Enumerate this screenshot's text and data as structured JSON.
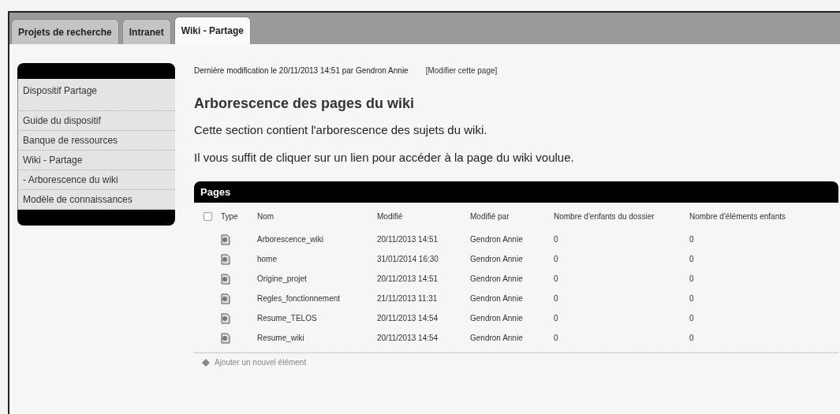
{
  "tabs": [
    {
      "label": "Projets de recherche",
      "selected": false
    },
    {
      "label": "Intranet",
      "selected": false
    },
    {
      "label": "Wiki - Partage",
      "selected": true
    }
  ],
  "sidebar": {
    "items": [
      {
        "label": "Dispositif Partage",
        "kind": "header"
      },
      {
        "label": "Guide du dispositif",
        "kind": "link"
      },
      {
        "label": "Banque de ressources",
        "kind": "link"
      },
      {
        "label": "Wiki - Partage",
        "kind": "link"
      },
      {
        "label": "- Arborescence du wiki",
        "kind": "link"
      },
      {
        "label": "Modèle de connaissances",
        "kind": "link"
      }
    ]
  },
  "meta": {
    "text": "Dernière modification le 20/11/2013 14:51 par Gendron Annie",
    "edit_link": "[Modifier cette page]"
  },
  "heading": "Arborescence des pages du wiki",
  "paragraphs": [
    "Cette section contient l'arborescence des sujets du wiki.",
    "Il vous suffit de cliquer sur un lien pour accéder à la page du wiki voulue."
  ],
  "table": {
    "title": "Pages",
    "select_all_checked": false,
    "columns": [
      "Type",
      "Nom",
      "Modifié",
      "Modifié par",
      "Nombre d'enfants du dossier",
      "Nombre d'éléments enfants"
    ],
    "rows": [
      {
        "cells": [
          "",
          "Arborescence_wiki",
          "20/11/2013 14:51",
          "Gendron Annie",
          "0",
          "0"
        ]
      },
      {
        "cells": [
          "",
          "home",
          "31/01/2014 16:30",
          "Gendron Annie",
          "0",
          "0"
        ]
      },
      {
        "cells": [
          "",
          "Origine_projet",
          "20/11/2013 14:51",
          "Gendron Annie",
          "0",
          "0"
        ]
      },
      {
        "cells": [
          "",
          "Regles_fonctionnement",
          "21/11/2013 11:31",
          "Gendron Annie",
          "0",
          "0"
        ]
      },
      {
        "cells": [
          "",
          "Resume_TELOS",
          "20/11/2013 14:54",
          "Gendron Annie",
          "0",
          "0"
        ]
      },
      {
        "cells": [
          "",
          "Resume_wiki",
          "20/11/2013 14:54",
          "Gendron Annie",
          "0",
          "0"
        ]
      }
    ],
    "add_link": "Ajouter un nouvel élément"
  }
}
